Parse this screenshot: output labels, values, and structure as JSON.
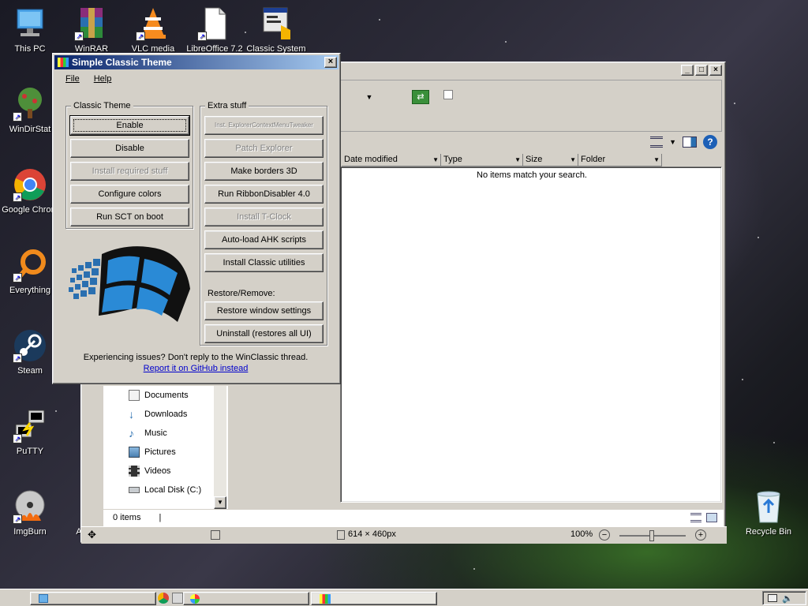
{
  "desktop": {
    "icons": [
      {
        "label": "This PC",
        "icon": "computer-icon"
      },
      {
        "label": "WinDirStat",
        "icon": "tree-icon"
      },
      {
        "label": "Google Chrom",
        "icon": "chrome-icon"
      },
      {
        "label": "Everything",
        "icon": "magnifier-icon"
      },
      {
        "label": "Steam",
        "icon": "steam-icon"
      },
      {
        "label": "PuTTY",
        "icon": "putty-icon"
      },
      {
        "label": "ImgBurn",
        "icon": "disc-icon"
      },
      {
        "label": "WinRAR",
        "icon": "winrar-icon"
      },
      {
        "label": "VLC media",
        "icon": "vlc-icon"
      },
      {
        "label": "LibreOffice 7.2",
        "icon": "document-icon"
      },
      {
        "label": "Classic System",
        "icon": "system-icon"
      },
      {
        "label": "A",
        "icon": "app-icon"
      },
      {
        "label": "Recycle Bin",
        "icon": "recycle-bin-icon"
      }
    ]
  },
  "explorer": {
    "columns": [
      "Date modified",
      "Type",
      "Size",
      "Folder"
    ],
    "empty_message": "No items match your search.",
    "nav_items": [
      {
        "label": "Documents",
        "icon": "documents-icon"
      },
      {
        "label": "Downloads",
        "icon": "downloads-icon"
      },
      {
        "label": "Music",
        "icon": "music-icon"
      },
      {
        "label": "Pictures",
        "icon": "pictures-icon"
      },
      {
        "label": "Videos",
        "icon": "videos-icon"
      },
      {
        "label": "Local Disk (C:)",
        "icon": "drive-icon"
      }
    ],
    "status_items": "0 items",
    "dimensions": "614 × 460px",
    "zoom": "100%"
  },
  "dialog": {
    "title": "Simple Classic Theme",
    "menu": [
      "File",
      "Help"
    ],
    "classic_theme_group": "Classic Theme",
    "extra_stuff_group": "Extra stuff",
    "classic_buttons": [
      {
        "label": "Enable",
        "enabled": true,
        "default": true
      },
      {
        "label": "Disable",
        "enabled": true
      },
      {
        "label": "Install required stuff",
        "enabled": false
      },
      {
        "label": "Configure colors",
        "enabled": true
      },
      {
        "label": "Run SCT on boot",
        "enabled": true
      }
    ],
    "extra_buttons": [
      {
        "label": "Inst. ExplorerContextMenuTweaker",
        "enabled": false
      },
      {
        "label": "Patch Explorer",
        "enabled": false
      },
      {
        "label": "Make borders 3D",
        "enabled": true
      },
      {
        "label": "Run RibbonDisabler 4.0",
        "enabled": true
      },
      {
        "label": "Install T-Clock",
        "enabled": false
      },
      {
        "label": "Auto-load AHK scripts",
        "enabled": true
      },
      {
        "label": "Install Classic utilities",
        "enabled": true
      }
    ],
    "restore_label": "Restore/Remove:",
    "restore_buttons": [
      {
        "label": "Restore window settings"
      },
      {
        "label": "Uninstall (restores all UI)"
      }
    ],
    "issue_text": "Experiencing issues? Don't reply to the WinClassic thread.",
    "issue_link": "Report it on GitHub instead"
  },
  "colors": {
    "title_start": "#0a246a",
    "title_end": "#a6caf0",
    "face": "#d4d0c8",
    "link": "#0000cc"
  }
}
